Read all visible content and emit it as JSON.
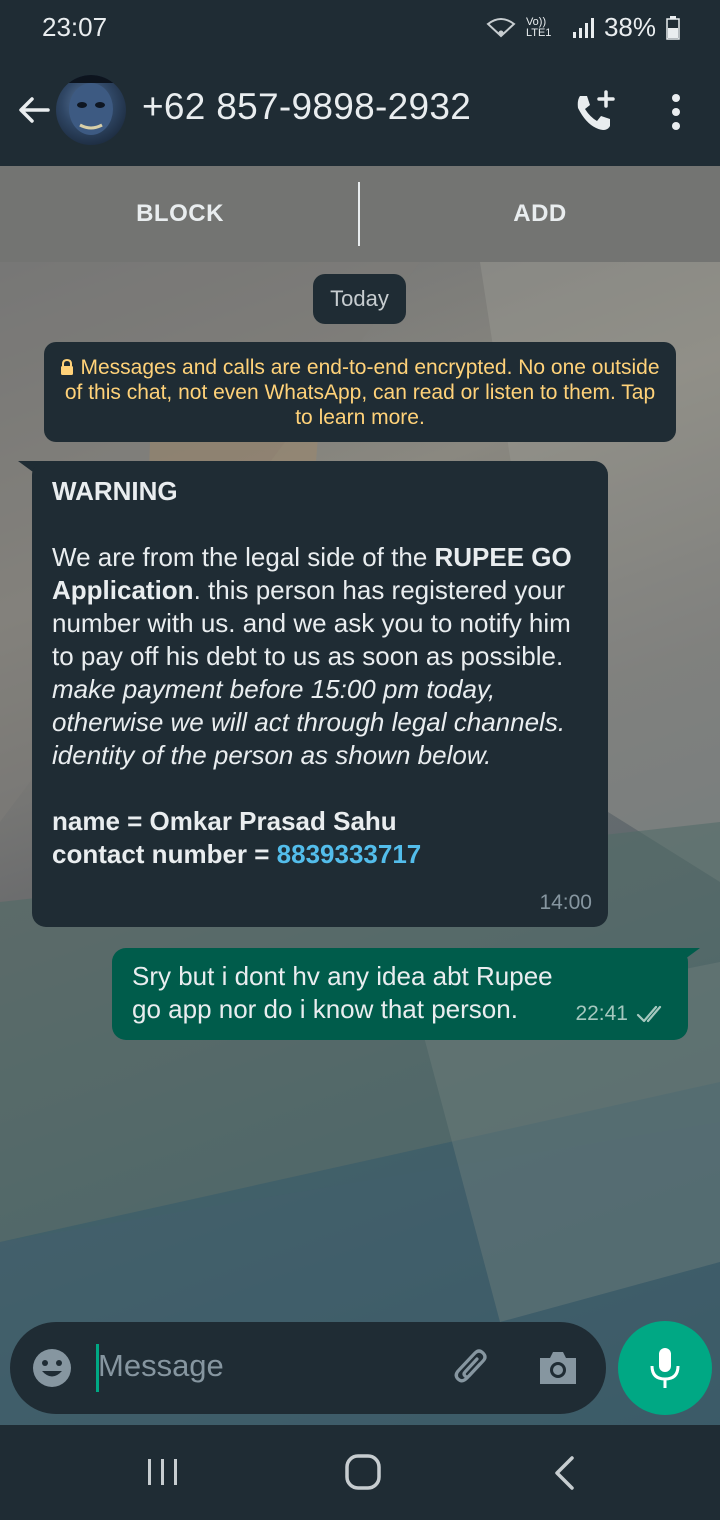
{
  "status_bar": {
    "time": "23:07",
    "battery": "38%",
    "network_label": "Vo)) LTE1",
    "icons": [
      "wifi-icon",
      "signal-icon",
      "battery-icon"
    ]
  },
  "app_bar": {
    "title": "+62 857-9898-2932",
    "icons": [
      "back-arrow-icon",
      "avatar",
      "add-call-icon",
      "more-vert-icon"
    ]
  },
  "action_bar": {
    "block_label": "BLOCK",
    "add_label": "ADD"
  },
  "chat": {
    "date_chip": "Today",
    "encryption_notice": "Messages and calls are end-to-end encrypted. No one outside of this chat, not even WhatsApp, can read or listen to them. Tap to learn more.",
    "incoming": {
      "heading": "WARNING",
      "body_1": "We are from the legal side of the ",
      "body_bold": "RUPEE GO Application",
      "body_2": ". this person has registered your number with us. and we ask you to notify him to pay off his debt to us as soon as possible. ",
      "body_italic": "make payment before 15:00 pm today, otherwise we will act through legal channels. identity of the person as shown below.",
      "name_line": "name = Omkar Prasad Sahu",
      "contact_label": "contact number = ",
      "contact_number": "8839333717",
      "time": "14:00"
    },
    "outgoing": {
      "text": "Sry but i dont hv any idea abt Rupee go app nor do i know that person.",
      "time": "22:41",
      "status": "read"
    }
  },
  "input": {
    "placeholder": "Message",
    "icons": [
      "emoji-icon",
      "attach-icon",
      "camera-icon",
      "mic-icon"
    ]
  },
  "colors": {
    "header_bg": "#1f2c34",
    "outgoing_bubble": "#005c4b",
    "accent": "#00a884",
    "encryption_text": "#ffd279",
    "link": "#53bdeb"
  }
}
